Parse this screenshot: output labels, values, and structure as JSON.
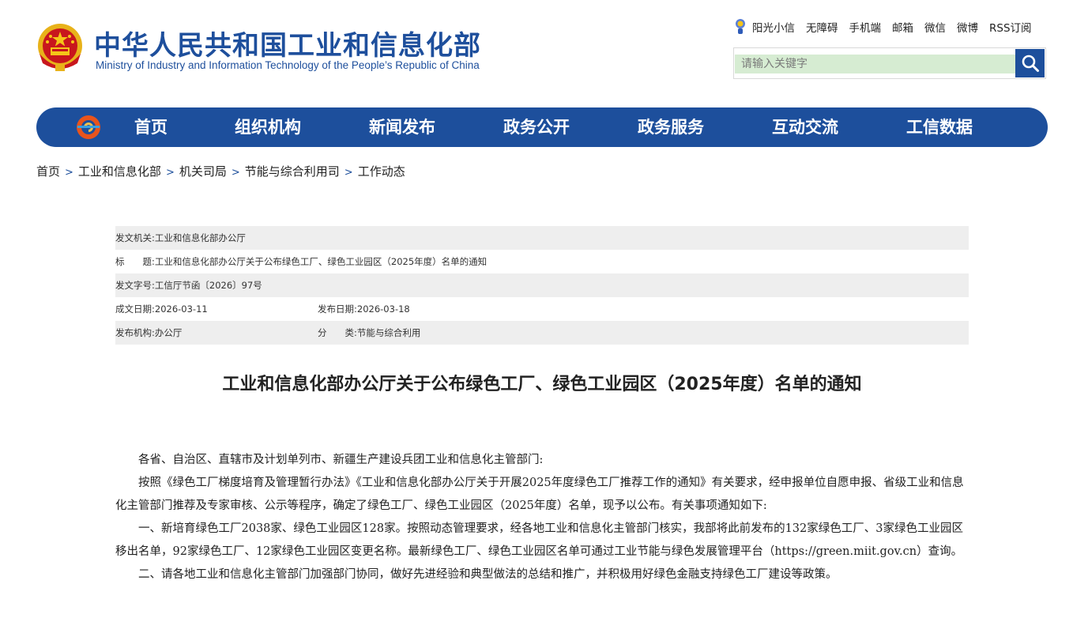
{
  "header": {
    "site_title": "中华人民共和国工业和信息化部",
    "site_subtitle": "Ministry of Industry and Information Technology of the People’s Republic of China",
    "top_links": [
      "阳光小信",
      "无障碍",
      "手机端",
      "邮箱",
      "微信",
      "微博",
      "RSS订阅"
    ],
    "search_placeholder": "请输入关键字"
  },
  "nav": {
    "items": [
      "首页",
      "组织机构",
      "新闻发布",
      "政务公开",
      "政务服务",
      "互动交流",
      "工信数据"
    ]
  },
  "breadcrumb": [
    "首页",
    "工业和信息化部",
    "机关司局",
    "节能与综合利用司",
    "工作动态"
  ],
  "meta": {
    "issuer_label": "发文机关:",
    "issuer": "工业和信息化部办公厅",
    "title_label": "标　　题:",
    "title": "工业和信息化部办公厅关于公布绿色工厂、绿色工业园区（2025年度）名单的通知",
    "doc_no_label": "发文字号:",
    "doc_no": "工信厅节函〔2026〕97号",
    "written_label": "成文日期:",
    "written_date": "2026-03-11",
    "published_label": "发布日期:",
    "published_date": "2026-03-18",
    "agency_label": "发布机构:",
    "agency": "办公厅",
    "category_label": "分　　类:",
    "category": "节能与综合利用"
  },
  "article": {
    "title": "工业和信息化部办公厅关于公布绿色工厂、绿色工业园区（2025年度）名单的通知",
    "paragraphs": [
      "各省、自治区、直辖市及计划单列市、新疆生产建设兵团工业和信息化主管部门:",
      "按照《绿色工厂梯度培育及管理暂行办法》《工业和信息化部办公厅关于开展2025年度绿色工厂推荐工作的通知》有关要求，经申报单位自愿申报、省级工业和信息化主管部门推荐及专家审核、公示等程序，确定了绿色工厂、绿色工业园区（2025年度）名单，现予以公布。有关事项通知如下:",
      "一、新培育绿色工厂2038家、绿色工业园区128家。按照动态管理要求，经各地工业和信息化主管部门核实，我部将此前发布的132家绿色工厂、3家绿色工业园区移出名单，92家绿色工厂、12家绿色工业园区变更名称。最新绿色工厂、绿色工业园区名单可通过工业节能与绿色发展管理平台（https://green.miit.gov.cn）查询。",
      "二、请各地工业和信息化主管部门加强部门协同，做好先进经验和典型做法的总结和推广，并积极用好绿色金融支持绿色工厂建设等政策。"
    ]
  },
  "colors": {
    "brand_blue": "#1d4f9c",
    "search_bg": "#d6ecd2",
    "meta_row_gray": "#eeeeee"
  }
}
